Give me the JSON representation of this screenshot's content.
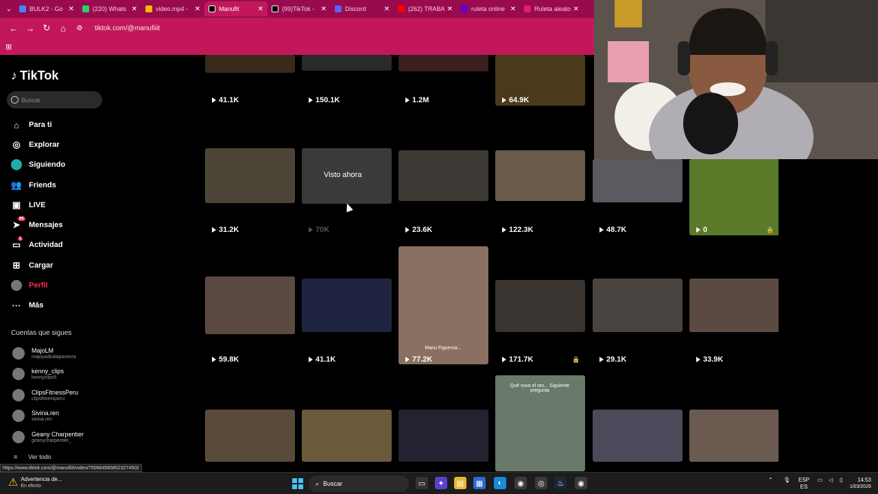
{
  "browser": {
    "tabs": [
      {
        "label": "BULK2 - Go",
        "color": "#4285f4",
        "active": false
      },
      {
        "label": "(220) Whats",
        "color": "#25d366",
        "active": false
      },
      {
        "label": "video.mp4 -",
        "color": "#fbbc04",
        "active": false
      },
      {
        "label": "Manufit",
        "color": "#000000",
        "active": true
      },
      {
        "label": "(99)TikTok -",
        "color": "#000000",
        "active": false
      },
      {
        "label": "Discord",
        "color": "#5865f2",
        "active": false
      },
      {
        "label": "(262) TRABA",
        "color": "#ff0000",
        "active": false
      },
      {
        "label": "ruleta online",
        "color": "#6001d2",
        "active": false
      },
      {
        "label": "Ruleta aleato",
        "color": "#e91e63",
        "active": false
      }
    ],
    "url": "tiktok.com/@manufiiit",
    "status_url": "https://www.tiktok.com/@manufiiit/video/7506645658523274502"
  },
  "sidebar": {
    "logo": "TikTok",
    "search_placeholder": "Buscar",
    "menu": [
      {
        "label": "Para ti",
        "icon": "home-icon",
        "glyph": "⌂",
        "active": false,
        "badge": ""
      },
      {
        "label": "Explorar",
        "icon": "compass-icon",
        "glyph": "◎",
        "active": false,
        "badge": ""
      },
      {
        "label": "Siguiendo",
        "icon": "following-avatar-icon",
        "glyph": "●",
        "active": false,
        "badge": ""
      },
      {
        "label": "Friends",
        "icon": "friends-icon",
        "glyph": "👥",
        "active": false,
        "badge": ""
      },
      {
        "label": "LIVE",
        "icon": "live-icon",
        "glyph": "▣",
        "active": false,
        "badge": ""
      },
      {
        "label": "Mensajes",
        "icon": "messages-icon",
        "glyph": "➤",
        "active": false,
        "badge": "95"
      },
      {
        "label": "Actividad",
        "icon": "activity-icon",
        "glyph": "▭",
        "active": false,
        "badge": "1"
      },
      {
        "label": "Cargar",
        "icon": "upload-icon",
        "glyph": "⊞",
        "active": false,
        "badge": ""
      },
      {
        "label": "Perfil",
        "icon": "profile-avatar-icon",
        "glyph": "●",
        "active": true,
        "badge": ""
      },
      {
        "label": "Más",
        "icon": "more-icon",
        "glyph": "···",
        "active": false,
        "badge": ""
      }
    ],
    "following_title": "Cuentas que sigues",
    "following": [
      {
        "name": "MajoLM",
        "handle": "majoyadiralapameza"
      },
      {
        "name": "kenny_clips",
        "handle": "kennyclips5"
      },
      {
        "name": "ClipsFitnessPeru",
        "handle": "clipsfitnessperu"
      },
      {
        "name": "Sivina.ren",
        "handle": "sivina.ren"
      },
      {
        "name": "Geany Charpentier",
        "handle": "geanycharpentier_"
      }
    ],
    "see_all": "Ver todo"
  },
  "grid": {
    "rows": [
      [
        {
          "views": "41.1K",
          "color": "#3a2a1c",
          "dim": false,
          "lock": false
        },
        {
          "views": "150.1K",
          "color": "#2a2a2a",
          "dim": false,
          "lock": false
        },
        {
          "views": "1.2M",
          "color": "#3b1e1e",
          "dim": false,
          "lock": false
        },
        {
          "views": "64.9K",
          "color": "#4a3a1a",
          "dim": false,
          "lock": false
        }
      ],
      [
        {
          "views": "31.2K",
          "color": "#4c4436",
          "dim": false,
          "lock": false
        },
        {
          "views": "70K",
          "color": "#3a3a3a",
          "dim": true,
          "lock": false,
          "overlay": "Visto ahora"
        },
        {
          "views": "23.6K",
          "color": "#3d3a36",
          "dim": false,
          "lock": false
        },
        {
          "views": "122.3K",
          "color": "#6a5a4a",
          "dim": false,
          "lock": false
        },
        {
          "views": "48.7K",
          "color": "#5a5a60",
          "dim": false,
          "lock": false
        },
        {
          "views": "0",
          "color": "#5a7a2a",
          "dim": false,
          "lock": true
        }
      ],
      [
        {
          "views": "59.8K",
          "color": "#5a4a42",
          "dim": false,
          "lock": false
        },
        {
          "views": "41.1K",
          "color": "#1e2440",
          "dim": false,
          "lock": false
        },
        {
          "views": "77.2K",
          "color": "#8a7060",
          "dim": false,
          "lock": false,
          "caption": "Manu Figueroa..."
        },
        {
          "views": "171.7K",
          "color": "#3a3430",
          "dim": false,
          "lock": true
        },
        {
          "views": "29.1K",
          "color": "#4a4440",
          "dim": false,
          "lock": false
        },
        {
          "views": "33.9K",
          "color": "#5a4a42",
          "dim": false,
          "lock": false
        }
      ],
      [
        {
          "views": "",
          "color": "#5a4a3a",
          "dim": false,
          "lock": false
        },
        {
          "views": "",
          "color": "#6a5a3a",
          "dim": false,
          "lock": false
        },
        {
          "views": "",
          "color": "#222230",
          "dim": false,
          "lock": false
        },
        {
          "views": "",
          "color": "#6a7a6a",
          "dim": false,
          "lock": false,
          "caption": "Qué vuva el ran... Siguiente pregunta"
        },
        {
          "views": "",
          "color": "#4a4a5a",
          "dim": false,
          "lock": false
        },
        {
          "views": "",
          "color": "#6a5a50",
          "dim": false,
          "lock": false
        }
      ]
    ]
  },
  "taskbar": {
    "notice_title": "Advertencia de...",
    "notice_sub": "En efecto",
    "search": "Buscar",
    "lang": "ESP",
    "lang_sub": "ES",
    "time": "14:53",
    "date": "1/03/2026"
  }
}
